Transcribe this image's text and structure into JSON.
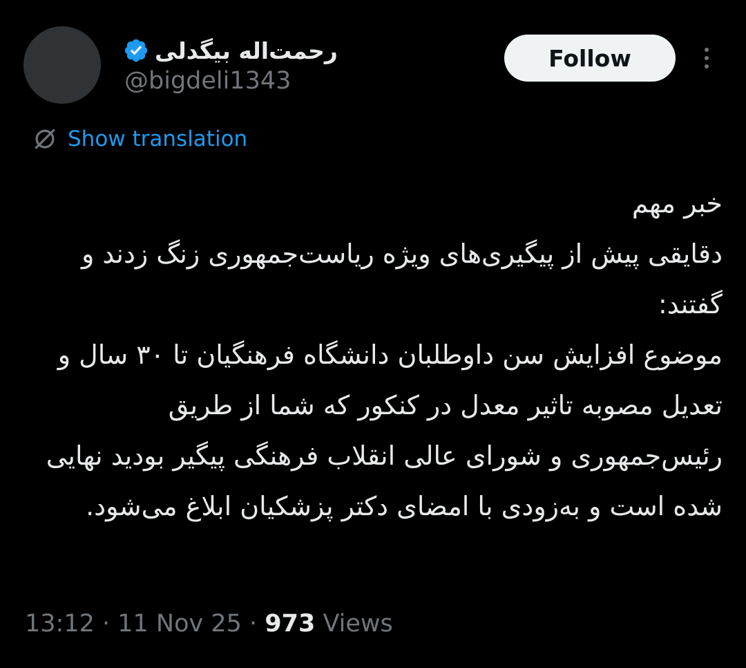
{
  "author": {
    "display_name": "رحمت‌اله بیگدلی",
    "handle": "@bigdeli1343",
    "verified": true
  },
  "actions": {
    "follow_label": "Follow",
    "more_icon": "more-vertical-icon"
  },
  "translation": {
    "label": "Show translation",
    "icon": "globe-icon"
  },
  "tweet": {
    "text": "خبر مهم\nدقایقی پیش از پیگیری‌های ویژه ریاست‌جمهوری زنگ زدند و گفتند:\nموضوع افزایش سن داوطلبان دانشگاه فرهنگیان تا ۳۰ سال و تعدیل مصوبه تاثیر معدل در کنکور که شما از طریق رئیس‌جمهوری و شورای عالی انقلاب فرهنگی پیگیر بودید نهایی شده است و به‌زودی با امضای دکتر پزشکیان ابلاغ می‌شود."
  },
  "meta": {
    "time": "13:12",
    "separator": " · ",
    "date": "11 Nov 25",
    "views_count": "973",
    "views_label": " Views"
  },
  "colors": {
    "background": "#000000",
    "text": "#e7e9ea",
    "secondary": "#71767b",
    "link": "#1d9bf0",
    "verified": "#1d9bf0"
  }
}
